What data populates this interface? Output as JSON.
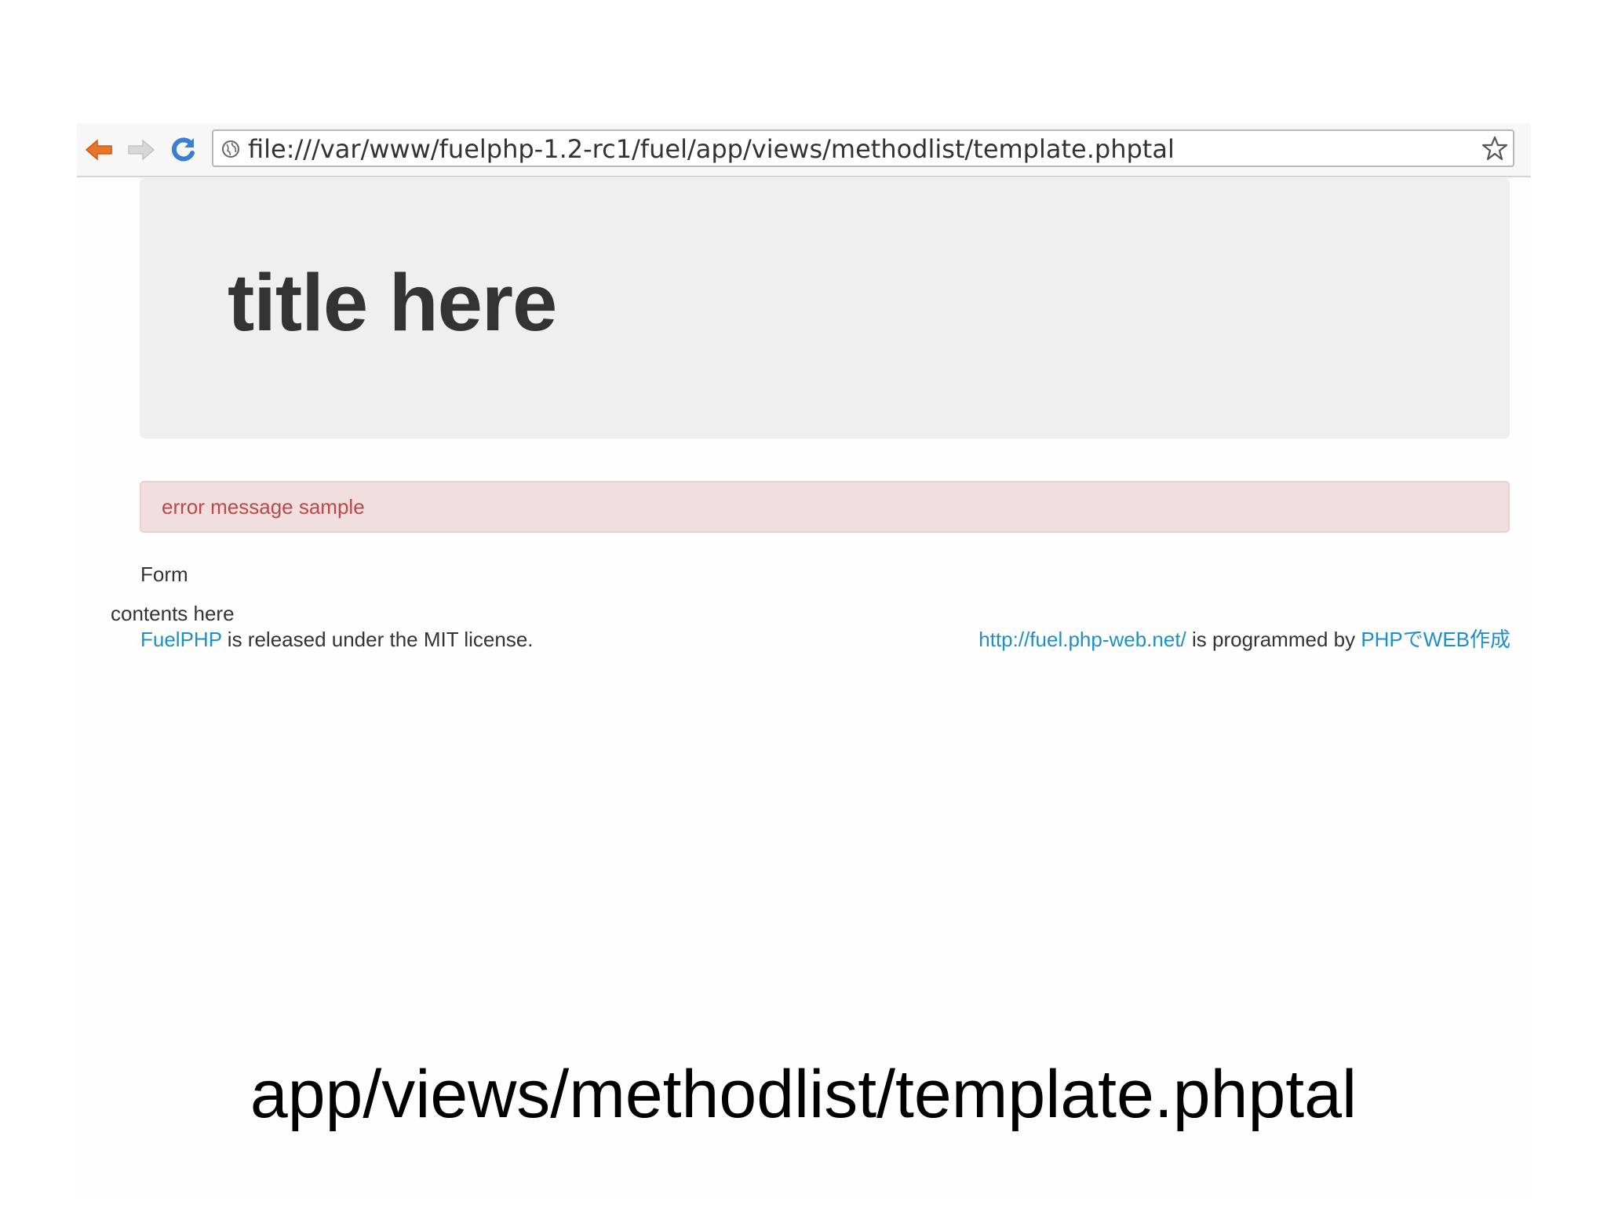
{
  "browser": {
    "url": "file:///var/www/fuelphp-1.2-rc1/fuel/app/views/methodlist/template.phptal",
    "icons": {
      "back": "arrow-left-icon",
      "forward": "arrow-right-icon",
      "reload": "reload-icon",
      "site": "globe-icon",
      "bookmark": "star-icon"
    },
    "colors": {
      "back_arrow": "#e8742a",
      "reload": "#3a7fd0"
    }
  },
  "page": {
    "title": "title here",
    "error_message": "error message sample",
    "form_label": "Form",
    "contents": "contents here",
    "footer": {
      "left_link": "FuelPHP",
      "left_text": " is released under the MIT license.",
      "right_link_1": "http://fuel.php-web.net/",
      "right_text": " is programmed by ",
      "right_link_2": "PHPでWEB作成"
    },
    "colors": {
      "hero_bg": "#f0eff0",
      "alert_bg": "#f1dede",
      "alert_text": "#b94a48",
      "link": "#1e90c8"
    }
  },
  "slide": {
    "caption": "app/views/methodlist/template.phptal"
  }
}
